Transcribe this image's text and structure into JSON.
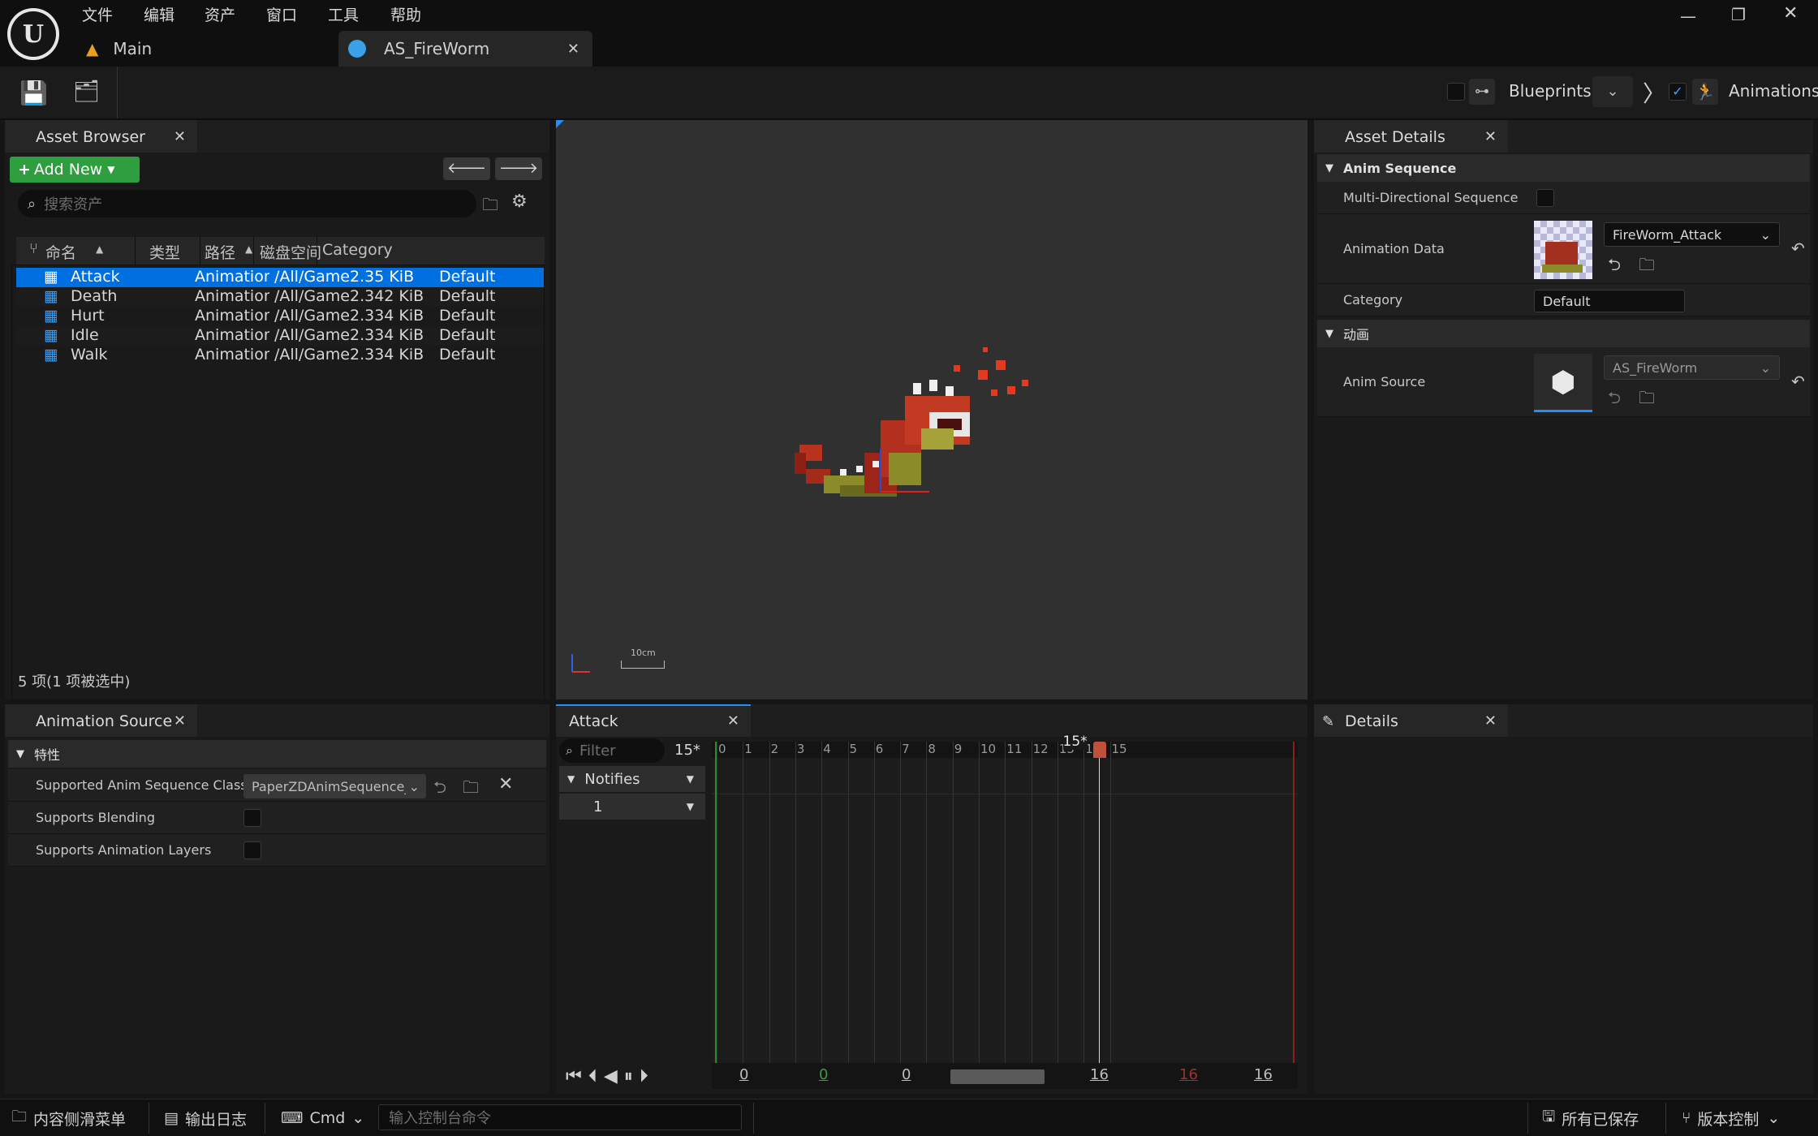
{
  "menu": {
    "file": "文件",
    "edit": "编辑",
    "asset": "资产",
    "window": "窗口",
    "tools": "工具",
    "help": "帮助"
  },
  "tabs": {
    "main": "Main",
    "active": "AS_FireWorm"
  },
  "toolbar": {
    "blueprints": "Blueprints",
    "animations": "Animations"
  },
  "asset_browser": {
    "title": "Asset Browser",
    "add_new": "Add New",
    "search_placeholder": "搜索资产",
    "columns": [
      "命名",
      "类型",
      "路径",
      "磁盘空间",
      "Category"
    ],
    "rows": [
      {
        "name": "Attack",
        "type": "Animation",
        "path": "/All/Game",
        "size": "2.35 KiB",
        "category": "Default",
        "selected": true
      },
      {
        "name": "Death",
        "type": "Animation",
        "path": "/All/Game",
        "size": "2.342 KiB",
        "category": "Default"
      },
      {
        "name": "Hurt",
        "type": "Animation",
        "path": "/All/Game",
        "size": "2.334 KiB",
        "category": "Default"
      },
      {
        "name": "Idle",
        "type": "Animation",
        "path": "/All/Game",
        "size": "2.334 KiB",
        "category": "Default"
      },
      {
        "name": "Walk",
        "type": "Animation",
        "path": "/All/Game",
        "size": "2.334 KiB",
        "category": "Default"
      }
    ],
    "footer": "5 项(1 项被选中)"
  },
  "viewport": {
    "scale_label": "10cm"
  },
  "asset_details": {
    "title": "Asset Details",
    "section1": "Anim Sequence",
    "multi_dir": "Multi-Directional Sequence",
    "anim_data": "Animation Data",
    "anim_data_value": "FireWorm_Attack",
    "category": "Category",
    "category_value": "Default",
    "section2": "动画",
    "anim_source": "Anim Source",
    "anim_source_value": "AS_FireWorm"
  },
  "animation_source": {
    "title": "Animation Source",
    "section": "特性",
    "class_label": "Supported Anim Sequence Class",
    "class_value": "PaperZDAnimSequence_",
    "blending": "Supports Blending",
    "layers": "Supports Animation Layers"
  },
  "timeline": {
    "title": "Attack",
    "filter_placeholder": "Filter",
    "frame_count": "15*",
    "notifies": "Notifies",
    "track": "1",
    "ticks": [
      "0",
      "1",
      "2",
      "3",
      "4",
      "5",
      "6",
      "7",
      "8",
      "9",
      "10",
      "11",
      "12",
      "13",
      "14",
      "15"
    ],
    "playhead_label": "15*",
    "range_values": [
      "0",
      "0",
      "0",
      "16",
      "16",
      "16"
    ]
  },
  "details": {
    "title": "Details"
  },
  "statusbar": {
    "content_drawer": "内容侧滑菜单",
    "output_log": "输出日志",
    "cmd": "Cmd",
    "cmd_placeholder": "输入控制台命令",
    "saved": "所有已保存",
    "source_control": "版本控制"
  },
  "colors": {
    "accent": "#0070e0",
    "add_new": "#2f9e3e",
    "selection": "#0070e0"
  }
}
